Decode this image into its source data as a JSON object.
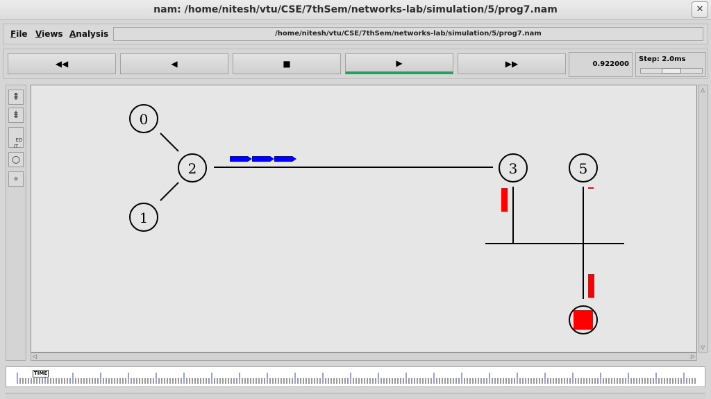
{
  "window": {
    "title": "nam: /home/nitesh/vtu/CSE/7thSem/networks-lab/simulation/5/prog7.nam",
    "close_glyph": "✕"
  },
  "menubar": {
    "items": [
      {
        "label": "File",
        "underline": "F",
        "rest": "ile"
      },
      {
        "label": "Views",
        "underline": "V",
        "rest": "iews"
      },
      {
        "label": "Analysis",
        "underline": "A",
        "rest": "nalysis"
      }
    ],
    "path": "/home/nitesh/vtu/CSE/7thSem/networks-lab/simulation/5/prog7.nam"
  },
  "controls": {
    "buttons": [
      {
        "name": "fast-rewind-button",
        "icon": "fast-rewind-icon",
        "glyph": "◀◀",
        "active": false
      },
      {
        "name": "play-backward-button",
        "icon": "play-backward-icon",
        "glyph": "◀",
        "active": false
      },
      {
        "name": "stop-button",
        "icon": "stop-icon",
        "glyph": "■",
        "active": false
      },
      {
        "name": "play-forward-button",
        "icon": "play-forward-icon",
        "glyph": "▶",
        "active": true
      },
      {
        "name": "fast-forward-button",
        "icon": "fast-forward-icon",
        "glyph": "▶▶",
        "active": false
      }
    ],
    "time": "0.922000",
    "step_label": "Step: 2.0ms",
    "step_slider_fraction": 0.5
  },
  "toolbar": {
    "tools": [
      {
        "name": "zoom-in-tool",
        "icon": "zoom-in-icon",
        "glyph": "⇞"
      },
      {
        "name": "zoom-out-tool",
        "icon": "zoom-out-icon",
        "glyph": "⇟"
      },
      {
        "name": "edit-tool",
        "icon": "edit-icon",
        "glyph": "ED\nIT"
      },
      {
        "name": "large-circle-tool",
        "icon": "circle-icon",
        "glyph": "○"
      },
      {
        "name": "small-circle-tool",
        "icon": "small-circle-icon",
        "glyph": "∘"
      }
    ]
  },
  "network": {
    "nodes": [
      {
        "id": "0",
        "label": "0"
      },
      {
        "id": "1",
        "label": "1"
      },
      {
        "id": "2",
        "label": "2"
      },
      {
        "id": "3",
        "label": "3"
      },
      {
        "id": "5",
        "label": "5"
      },
      {
        "id": "4",
        "label": ""
      }
    ],
    "colors": {
      "packet_blue": "#0000ff",
      "packet_red": "#ff0000",
      "link": "#000000",
      "canvas": "#e6e6e6"
    }
  },
  "timeline": {
    "marker_label": "TIME"
  }
}
